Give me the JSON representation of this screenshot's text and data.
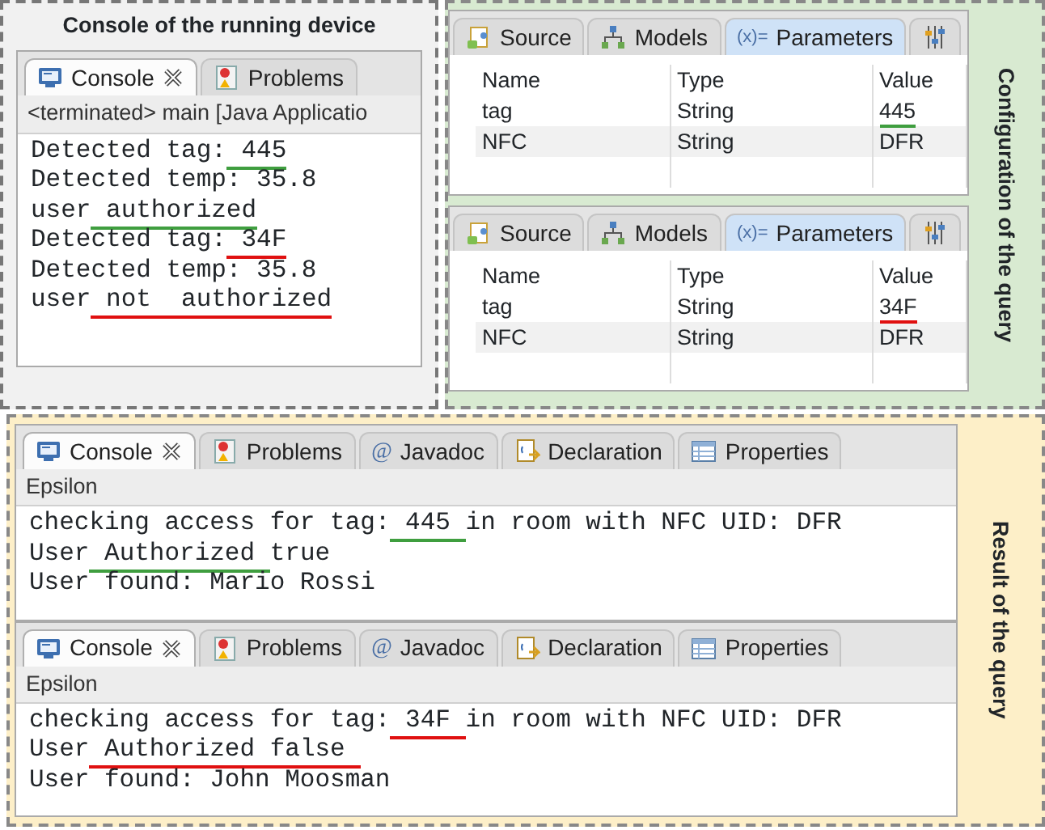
{
  "device_panel": {
    "title": "Console of the running device",
    "console": {
      "tabs": [
        {
          "kind": "console",
          "label": "Console",
          "selected": true,
          "closable": true
        },
        {
          "kind": "problems",
          "label": "Problems",
          "selected": false,
          "closable": false
        }
      ],
      "header": "<terminated> main [Java Applicatio",
      "lines": [
        [
          {
            "text": "Detected tag:"
          },
          {
            "text": " 445",
            "color": "#3f9e3f"
          }
        ],
        [
          {
            "text": "Detected temp: 35.8"
          }
        ],
        [
          {
            "text": "user"
          },
          {
            "text": " authorized",
            "color": "#3f9e3f"
          }
        ],
        [
          {
            "text": "Detected tag:"
          },
          {
            "text": " 34F",
            "color": "#e01010"
          }
        ],
        [
          {
            "text": "Detected temp: 35.8"
          }
        ],
        [
          {
            "text": "user"
          },
          {
            "text": " not  authorized",
            "color": "#e01010"
          }
        ]
      ]
    }
  },
  "query_panel": {
    "label": "Configuration of the query",
    "editors": [
      {
        "tabs": [
          {
            "kind": "source",
            "label": "Source",
            "selected": false
          },
          {
            "kind": "models",
            "label": "Models",
            "selected": false
          },
          {
            "kind": "parameters",
            "icon_text": "(x)=",
            "label": "Parameters",
            "selected": true
          },
          {
            "kind": "tool",
            "selected": false
          }
        ],
        "columns": [
          "Name",
          "Type",
          "Value"
        ],
        "rows": [
          [
            {
              "text": "tag"
            },
            {
              "text": "String"
            },
            {
              "text": "445",
              "color": "#3f9e3f"
            }
          ],
          [
            {
              "text": "NFC"
            },
            {
              "text": "String"
            },
            {
              "text": "DFR"
            }
          ]
        ]
      },
      {
        "tabs": [
          {
            "kind": "source",
            "label": "Source",
            "selected": false
          },
          {
            "kind": "models",
            "label": "Models",
            "selected": false
          },
          {
            "kind": "parameters",
            "icon_text": "(x)=",
            "label": "Parameters",
            "selected": true
          },
          {
            "kind": "tool",
            "selected": false
          }
        ],
        "columns": [
          "Name",
          "Type",
          "Value"
        ],
        "rows": [
          [
            {
              "text": "tag"
            },
            {
              "text": "String"
            },
            {
              "text": "34F",
              "color": "#e01010"
            }
          ],
          [
            {
              "text": "NFC"
            },
            {
              "text": "String"
            },
            {
              "text": "DFR"
            }
          ]
        ]
      }
    ]
  },
  "result_panel": {
    "label": "Result of the query",
    "consoles": [
      {
        "tabs": [
          {
            "kind": "console",
            "label": "Console",
            "selected": true,
            "closable": true
          },
          {
            "kind": "problems",
            "label": "Problems",
            "selected": false,
            "closable": false
          },
          {
            "kind": "javadoc",
            "icon_text": "@",
            "label": "Javadoc",
            "selected": false,
            "closable": false
          },
          {
            "kind": "declaration",
            "label": "Declaration",
            "selected": false,
            "closable": false
          },
          {
            "kind": "properties",
            "label": "Properties",
            "selected": false,
            "closable": false
          }
        ],
        "header": "Epsilon",
        "lines": [
          [
            {
              "text": "checking access for tag:"
            },
            {
              "text": " 445 ",
              "color": "#3f9e3f"
            },
            {
              "text": "in room with NFC UID: DFR"
            }
          ],
          [
            {
              "text": "User"
            },
            {
              "text": " Authorized ",
              "color": "#3f9e3f"
            },
            {
              "text": "true"
            }
          ],
          [
            {
              "text": "User found: Mario Rossi"
            }
          ]
        ]
      },
      {
        "tabs": [
          {
            "kind": "console",
            "label": "Console",
            "selected": true,
            "closable": true
          },
          {
            "kind": "problems",
            "label": "Problems",
            "selected": false,
            "closable": false
          },
          {
            "kind": "javadoc",
            "icon_text": "@",
            "label": "Javadoc",
            "selected": false,
            "closable": false
          },
          {
            "kind": "declaration",
            "label": "Declaration",
            "selected": false,
            "closable": false
          },
          {
            "kind": "properties",
            "label": "Properties",
            "selected": false,
            "closable": false
          }
        ],
        "header": "Epsilon",
        "lines": [
          [
            {
              "text": "checking access for tag:"
            },
            {
              "text": " 34F ",
              "color": "#e01010"
            },
            {
              "text": "in room with NFC UID: DFR"
            }
          ],
          [
            {
              "text": "User"
            },
            {
              "text": " Authorized false ",
              "color": "#e01010"
            }
          ],
          [
            {
              "text": "User found: John Moosman"
            }
          ]
        ]
      }
    ]
  }
}
